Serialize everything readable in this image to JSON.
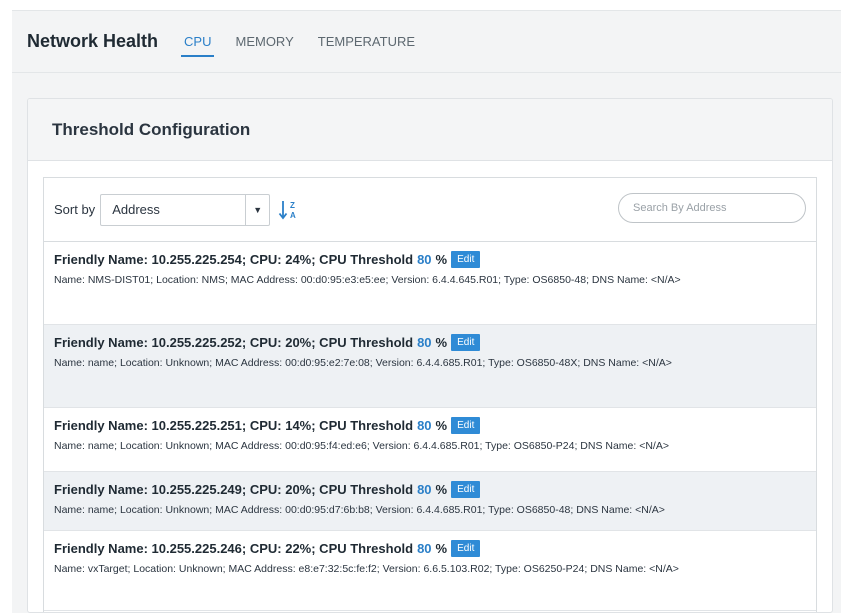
{
  "header": {
    "title": "Network Health",
    "tabs": [
      {
        "label": "CPU",
        "active": true
      },
      {
        "label": "MEMORY",
        "active": false
      },
      {
        "label": "TEMPERATURE",
        "active": false
      }
    ]
  },
  "panel": {
    "title": "Threshold Configuration",
    "sort_label": "Sort by",
    "sort_value": "Address",
    "search_placeholder": "Search By Address"
  },
  "rows": [
    {
      "main": "Friendly Name: 10.255.225.254; CPU: 24%; CPU Threshold",
      "threshold": "80",
      "pct": "%",
      "edit": "Edit",
      "detail": "Name: NMS-DIST01; Location: NMS; MAC Address: 00:d0:95:e3:e5:ee; Version: 6.4.4.645.R01; Type: OS6850-48; DNS Name: <N/A>"
    },
    {
      "main": "Friendly Name: 10.255.225.252; CPU: 20%; CPU Threshold",
      "threshold": "80",
      "pct": "%",
      "edit": "Edit",
      "detail": "Name: name; Location: Unknown; MAC Address: 00:d0:95:e2:7e:08; Version: 6.4.4.685.R01; Type: OS6850-48X; DNS Name: <N/A>"
    },
    {
      "main": "Friendly Name: 10.255.225.251; CPU: 14%; CPU Threshold",
      "threshold": "80",
      "pct": "%",
      "edit": "Edit",
      "detail": "Name: name; Location: Unknown; MAC Address: 00:d0:95:f4:ed:e6; Version: 6.4.4.685.R01; Type: OS6850-P24; DNS Name: <N/A>"
    },
    {
      "main": "Friendly Name: 10.255.225.249; CPU: 20%; CPU Threshold",
      "threshold": "80",
      "pct": "%",
      "edit": "Edit",
      "detail": "Name: name; Location: Unknown; MAC Address: 00:d0:95:d7:6b:b8; Version: 6.4.4.685.R01; Type: OS6850-48; DNS Name: <N/A>"
    },
    {
      "main": "Friendly Name: 10.255.225.246; CPU: 22%; CPU Threshold",
      "threshold": "80",
      "pct": "%",
      "edit": "Edit",
      "detail": "Name: vxTarget; Location: Unknown; MAC Address: e8:e7:32:5c:fe:f2; Version: 6.6.5.103.R02; Type: OS6250-P24; DNS Name: <N/A>"
    }
  ],
  "icons": {
    "sort": "sort-alpha-icon",
    "caret": "caret-down-icon"
  },
  "colors": {
    "accent": "#2a7fc8",
    "edit_button": "#2f8bd6",
    "alt_row": "#eef1f4"
  }
}
